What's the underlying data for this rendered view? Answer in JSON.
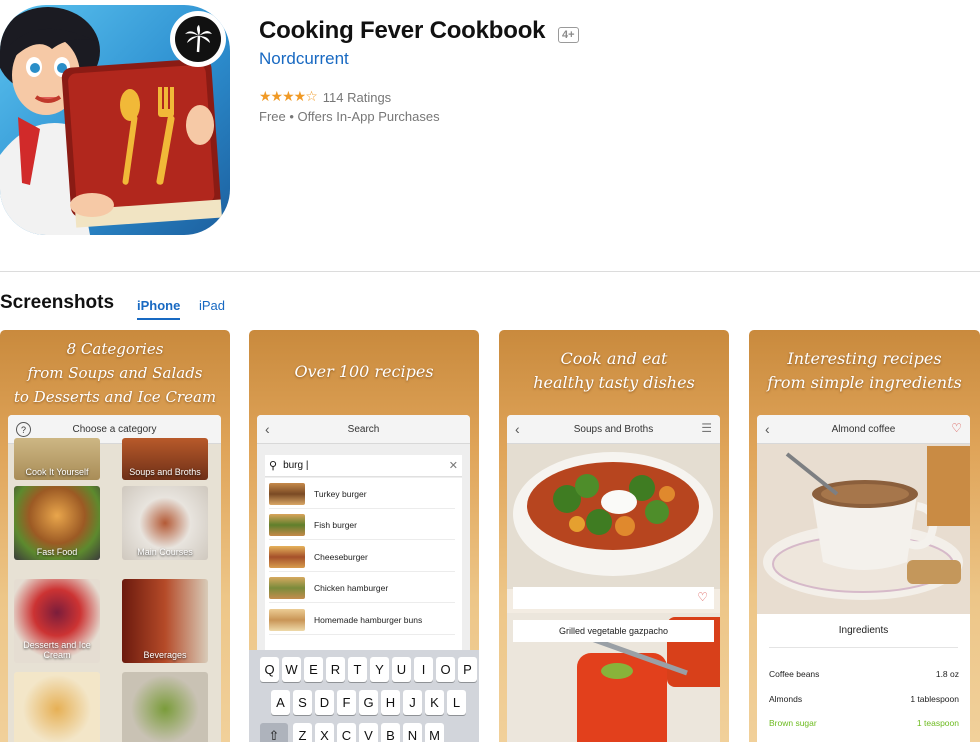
{
  "app": {
    "title": "Cooking Fever Cookbook",
    "age_rating": "4+",
    "developer": "Nordcurrent",
    "stars": "★★★★☆",
    "star_value": 4,
    "ratings_count": "114 Ratings",
    "price": "Free • Offers In-App Purchases"
  },
  "screenshots_section": {
    "title": "Screenshots",
    "tabs": [
      "iPhone",
      "iPad"
    ]
  },
  "shot1": {
    "caption": [
      "8 Categories",
      "from Soups and Salads",
      "to Desserts and Ice Cream"
    ],
    "nav_title": "Choose a category",
    "categories": [
      "Cook It Yourself",
      "Soups and Broths",
      "Fast Food",
      "Main Courses",
      "Desserts and Ice Cream",
      "Beverages"
    ]
  },
  "shot2": {
    "caption": "Over 100 recipes",
    "nav_title": "Search",
    "query": "burg |",
    "results": [
      "Turkey burger",
      "Fish burger",
      "Cheeseburger",
      "Chicken hamburger",
      "Homemade hamburger buns"
    ],
    "keys_row1": [
      "Q",
      "W",
      "E",
      "R",
      "T",
      "Y",
      "U",
      "I",
      "O",
      "P"
    ],
    "keys_row2": [
      "A",
      "S",
      "D",
      "F",
      "G",
      "H",
      "J",
      "K",
      "L"
    ],
    "keys_row3": [
      "Z",
      "X",
      "C",
      "V",
      "B",
      "N",
      "M"
    ]
  },
  "shot3": {
    "caption": [
      "Cook and eat",
      "healthy tasty dishes"
    ],
    "nav_title": "Soups and Broths",
    "recipe": "Grilled vegetable gazpacho"
  },
  "shot4": {
    "caption": [
      "Interesting recipes",
      "from simple ingredients"
    ],
    "nav_title": "Almond coffee",
    "ingredients_title": "Ingredients",
    "ingredients": [
      {
        "name": "Coffee beans",
        "amount": "1.8 oz"
      },
      {
        "name": "Almonds",
        "amount": "1 tablespoon"
      },
      {
        "name": "Brown sugar",
        "amount": "1 teaspoon"
      }
    ]
  },
  "colors": {
    "accent": "#1869c2",
    "star": "#f09a26",
    "highlight": "#6dbb1f"
  }
}
